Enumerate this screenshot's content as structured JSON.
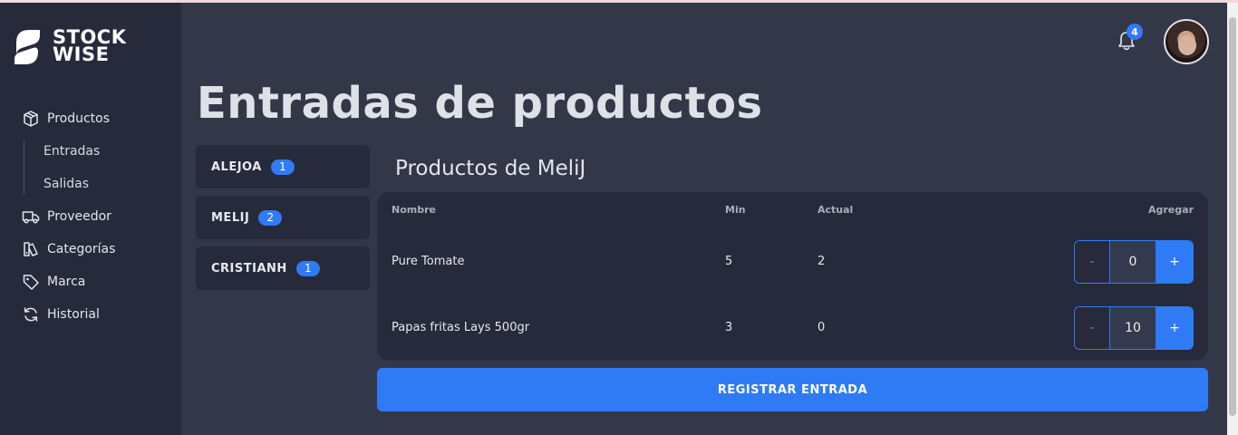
{
  "brand": {
    "line1": "STOCK",
    "line2": "WISE"
  },
  "sidebar": {
    "items": [
      {
        "label": "Productos",
        "icon": "box-icon"
      },
      {
        "label": "Proveedor",
        "icon": "truck-icon"
      },
      {
        "label": "Categorías",
        "icon": "category-icon"
      },
      {
        "label": "Marca",
        "icon": "tag-icon"
      },
      {
        "label": "Historial",
        "icon": "refresh-icon"
      }
    ],
    "subitems": [
      "Entradas",
      "Salidas"
    ]
  },
  "header": {
    "notifications": "4"
  },
  "page": {
    "title": "Entradas de productos"
  },
  "users": [
    {
      "name": "ALEJOA",
      "count": "1"
    },
    {
      "name": "MELIJ",
      "count": "2"
    },
    {
      "name": "CRISTIANH",
      "count": "1"
    }
  ],
  "products": {
    "title": "Productos de MeliJ",
    "headers": {
      "name": "Nombre",
      "min": "Min",
      "actual": "Actual",
      "add": "Agregar"
    },
    "rows": [
      {
        "name": "Pure Tomate",
        "min": "5",
        "actual": "2",
        "qty": "0"
      },
      {
        "name": "Papas fritas Lays 500gr",
        "min": "3",
        "actual": "0",
        "qty": "10"
      }
    ],
    "minus": "-",
    "plus": "+"
  },
  "submit_label": "REGISTRAR ENTRADA",
  "colors": {
    "accent": "#2f7bf5",
    "sidebar": "#262a3a",
    "background": "#333849"
  }
}
